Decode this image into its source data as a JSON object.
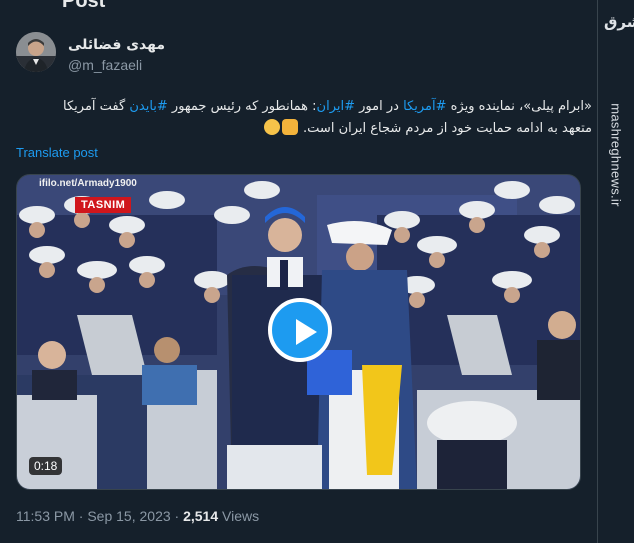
{
  "header": {
    "title": "Post"
  },
  "watermark": {
    "logo_text": "مشرق",
    "site": "mashreghnews.ir"
  },
  "author": {
    "name": "مهدی فضائلی",
    "handle": "@m_fazaeli"
  },
  "tweet": {
    "line1_a": "«ابرام پیلی»، نماینده ویژه ",
    "tag_america": "#آمریکا",
    "line1_b": " در امور ",
    "tag_iran": "#ایران",
    "line1_c": ": همانطور که رئیس جمهور ",
    "tag_biden": "#بایدن",
    "line1_d": " گفت آمریکا",
    "line2": "متعهد به ادامه حمایت خود از مردم شجاع ایران است."
  },
  "translate_label": "Translate post",
  "media": {
    "source_tag": "ifilo.net/Armady1900",
    "channel_badge": "TASNIM",
    "duration": "0:18"
  },
  "meta": {
    "time": "11:53 PM",
    "sep": " · ",
    "date": "Sep 15, 2023",
    "views_count": "2,514",
    "views_label": " Views"
  },
  "icons": [
    "play-icon",
    "thinking-emoji",
    "point-down-emoji",
    "avatar-photo"
  ],
  "colors": {
    "background": "#15202b",
    "accent": "#1d9bf0",
    "muted": "#8b98a5",
    "badge": "#d0161c"
  }
}
